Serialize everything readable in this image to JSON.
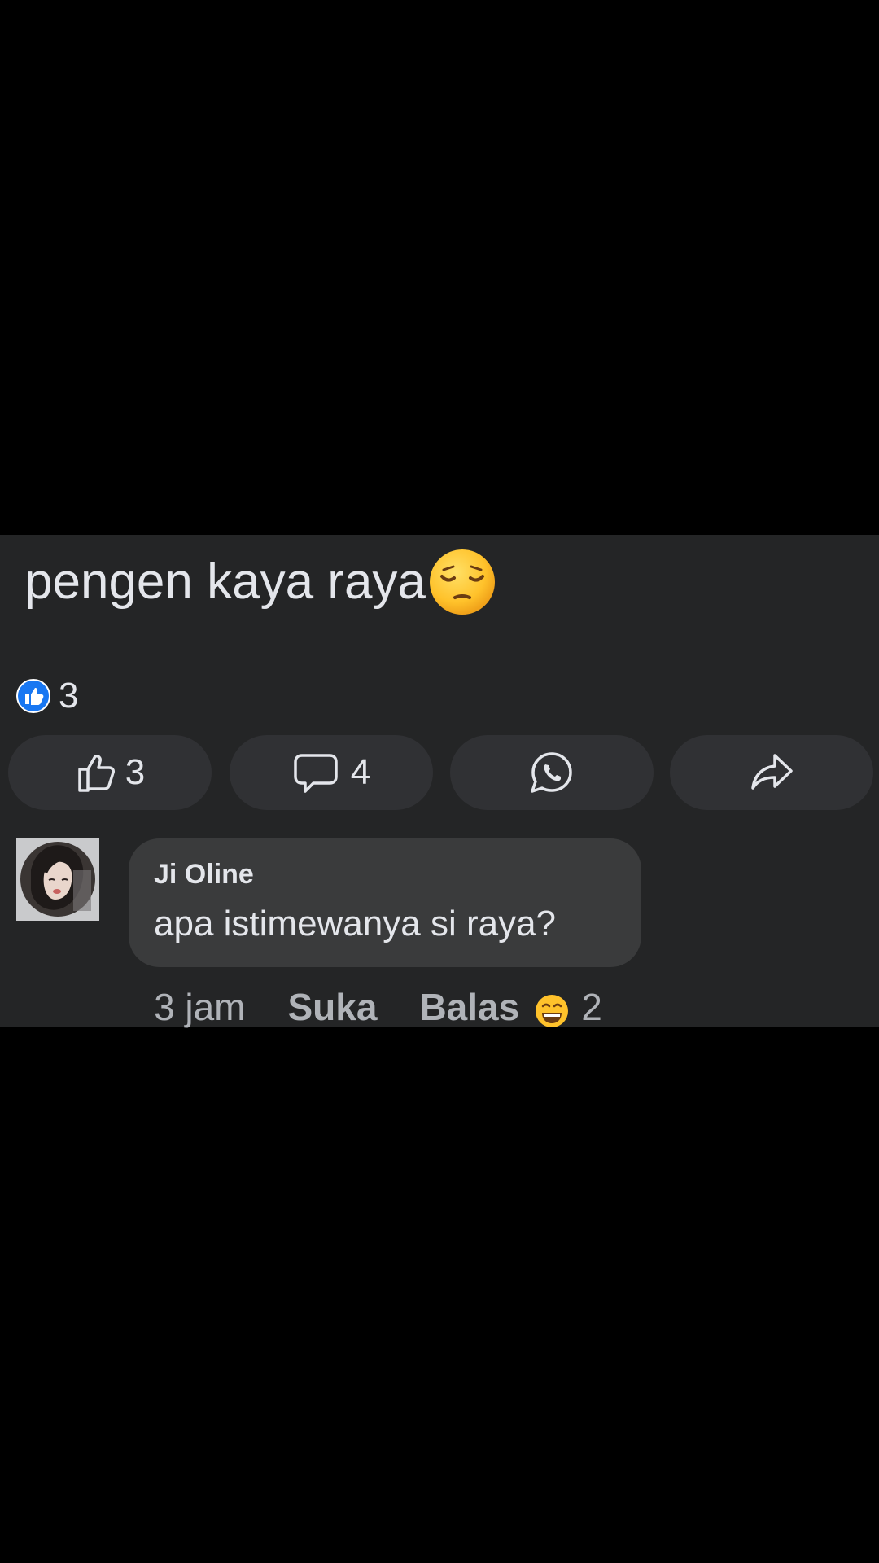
{
  "post": {
    "text": "pengen kaya raya",
    "emoji": "pensive-face",
    "reaction_count": "3"
  },
  "actions": {
    "like_count": "3",
    "comment_count": "4"
  },
  "comment": {
    "author": "Ji Oline",
    "text": "apa istimewanya si raya?",
    "time": "3 jam",
    "like_label": "Suka",
    "reply_label": "Balas",
    "reaction_emoji": "grinning-face",
    "reaction_count": "2"
  },
  "colors": {
    "background": "#000000",
    "panel": "#242526",
    "bubble": "#3a3b3c",
    "button": "#303134",
    "text": "#e4e6eb",
    "muted_text": "#b0b3b8",
    "like_blue": "#1877f2"
  }
}
